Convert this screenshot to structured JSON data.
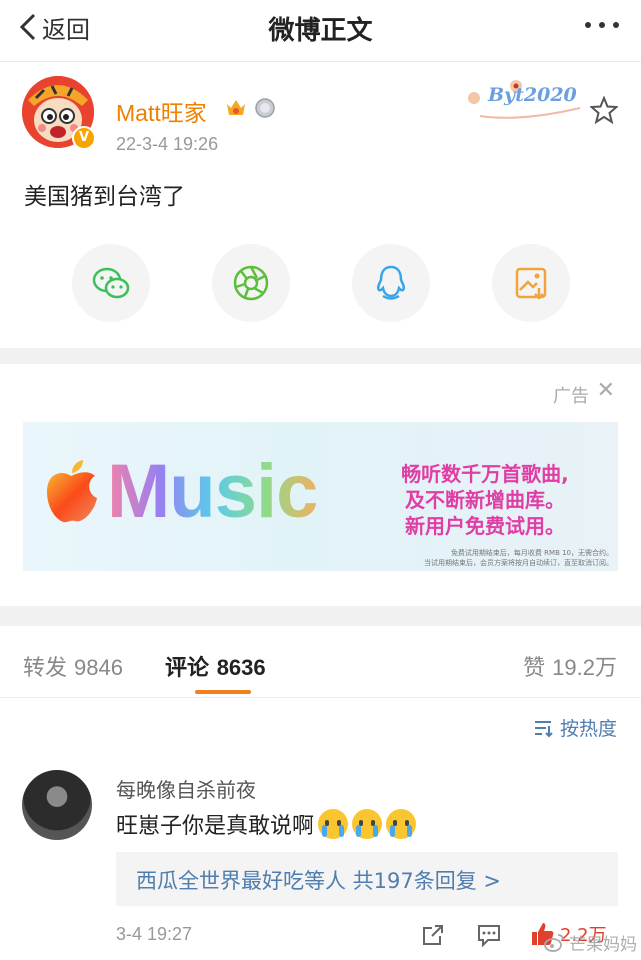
{
  "header": {
    "back_label": "返回",
    "title": "微博正文"
  },
  "post": {
    "username": "Matt旺家",
    "time": "22-3-4 19:26",
    "text": "美国猪到台湾了",
    "badge_text": "Byt2020"
  },
  "ad": {
    "label": "广告",
    "close_glyph": "✕",
    "brand": "Music",
    "promo_lines": [
      "畅听数千万首歌曲,",
      "及不断新增曲库。",
      "新用户免费试用。"
    ],
    "fine_print": [
      "免费试用期结束后，每月收费 RMB 10，无需合约。",
      "当试用期结束后，会员方案将按月自动续订，直至取消订阅。"
    ]
  },
  "tabs": {
    "repost": {
      "label": "转发",
      "count": "9846"
    },
    "comment": {
      "label": "评论",
      "count": "8636"
    },
    "like": {
      "label": "赞",
      "count": "19.2万"
    }
  },
  "sort": {
    "label": "按热度"
  },
  "comment": {
    "author": "每晚像自杀前夜",
    "text": "旺崽子你是真敢说啊",
    "reply_summary": "西瓜全世界最好吃等人  共197条回复 >",
    "time": "3-4 19:27",
    "like_count": "2.2万"
  },
  "watermark": "芒果妈妈",
  "colors": {
    "accent": "#f08000",
    "link": "#507daf",
    "like": "#e0402c",
    "tab_underline": "#f08020"
  }
}
